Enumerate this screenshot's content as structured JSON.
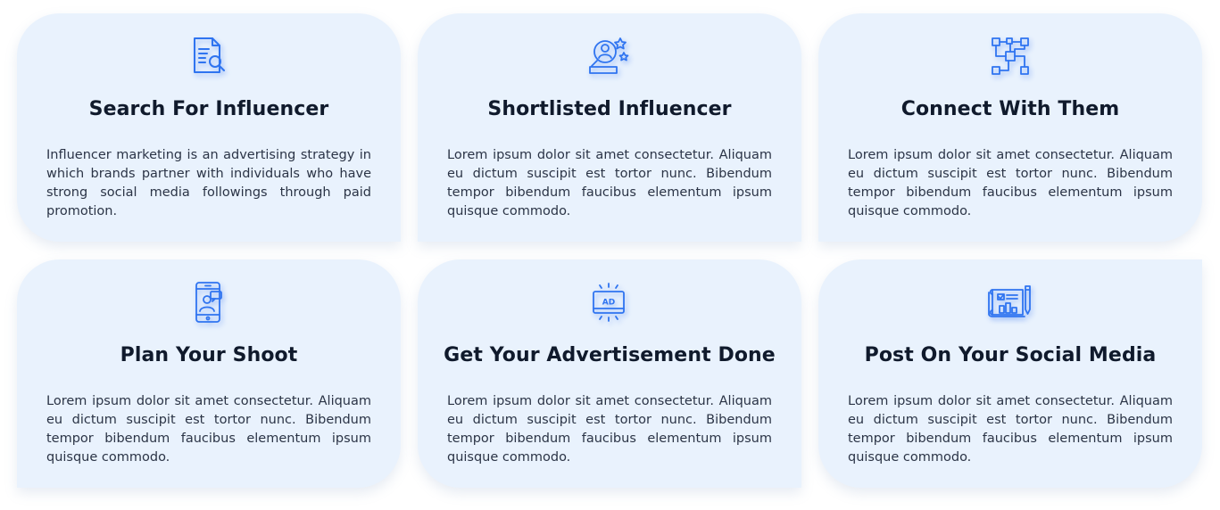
{
  "cards": [
    {
      "icon": "document-search-icon",
      "title": "Search For Influencer",
      "description": "Influencer marketing is an advertising strategy in which brands partner with individuals who have strong social media followings through paid promotion."
    },
    {
      "icon": "person-search-stars-icon",
      "title": "Shortlisted Influencer",
      "description": "Lorem ipsum dolor sit amet consectetur. Aliquam eu dictum suscipit est tortor nunc. Bibendum tempor bibendum faucibus elementum ipsum quisque commodo."
    },
    {
      "icon": "network-nodes-icon",
      "title": "Connect With Them",
      "description": "Lorem ipsum dolor sit amet consectetur. Aliquam eu dictum suscipit est tortor nunc. Bibendum tempor bibendum faucibus elementum ipsum quisque commodo."
    },
    {
      "icon": "mobile-profile-icon",
      "title": "Plan Your Shoot",
      "description": "Lorem ipsum dolor sit amet consectetur. Aliquam eu dictum suscipit est tortor nunc. Bibendum tempor bibendum faucibus elementum ipsum quisque commodo."
    },
    {
      "icon": "ad-screen-icon",
      "title": "Get Your Advertisement Done",
      "description": "Lorem ipsum dolor sit amet consectetur. Aliquam eu dictum suscipit est tortor nunc. Bibendum tempor bibendum faucibus elementum ipsum quisque commodo."
    },
    {
      "icon": "blueprint-pencil-icon",
      "title": "Post On Your Social Media",
      "description": "Lorem ipsum dolor sit amet consectetur. Aliquam eu dictum suscipit est tortor nunc. Bibendum tempor bibendum faucibus elementum ipsum quisque commodo."
    }
  ],
  "colors": {
    "card_background": "#e9f2fd",
    "icon_blue": "#2f74f0",
    "title_text": "#101a2c",
    "body_text": "#2b3446"
  },
  "icon_text": {
    "ad_label": "AD"
  }
}
